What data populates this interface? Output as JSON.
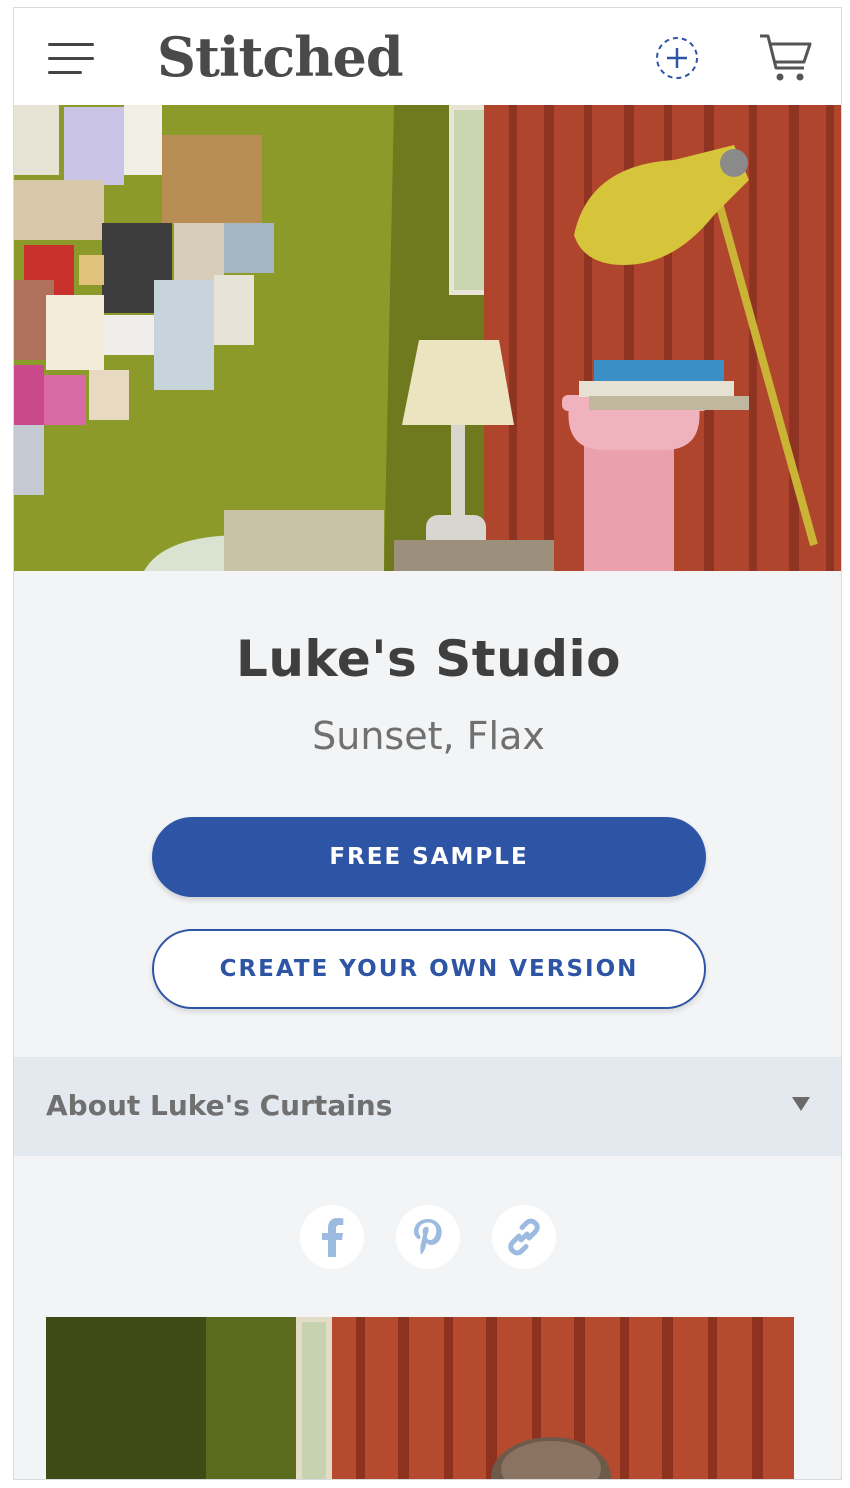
{
  "header": {
    "logo": "Stitched",
    "menu_icon": "hamburger-menu-icon",
    "add_icon": "dashed-plus-circle-icon",
    "cart_icon": "shopping-cart-icon"
  },
  "product": {
    "title": "Luke's Studio",
    "subtitle": "Sunset, Flax"
  },
  "actions": {
    "free_sample_label": "FREE SAMPLE",
    "create_version_label": "CREATE YOUR OWN VERSION"
  },
  "accordion": {
    "label": "About Luke's Curtains"
  },
  "share": {
    "icons": [
      "facebook-icon",
      "pinterest-icon",
      "link-icon"
    ]
  },
  "colors": {
    "brand_blue": "#2e55a5",
    "share_icon": "#9dbbe0",
    "curtain": "#b0452d",
    "wall": "#8c9a2a"
  }
}
